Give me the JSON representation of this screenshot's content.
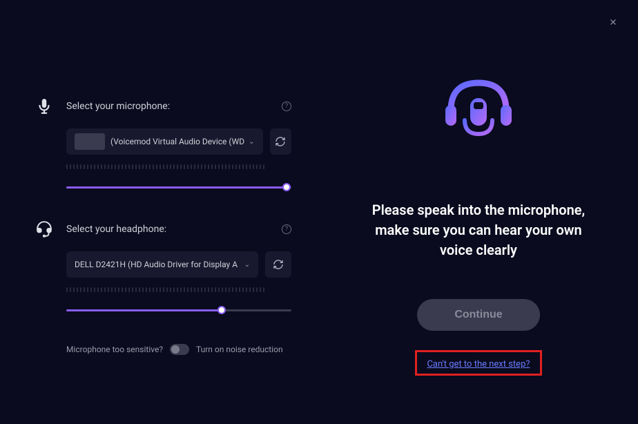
{
  "left": {
    "mic": {
      "label": "Select your microphone:",
      "selected": "(Voicemod Virtual Audio Device (WD",
      "slider_percent": 98
    },
    "headphone": {
      "label": "Select your headphone:",
      "selected": "DELL D2421H (HD Audio Driver for Display A",
      "slider_percent": 69
    },
    "noise": {
      "question": "Microphone too sensitive?",
      "action": "Turn on noise reduction",
      "enabled": false
    }
  },
  "right": {
    "instruction": "Please speak into the microphone, make sure you can hear your own voice clearly",
    "continue_label": "Continue",
    "help_link": "Can't get to the next step?"
  }
}
